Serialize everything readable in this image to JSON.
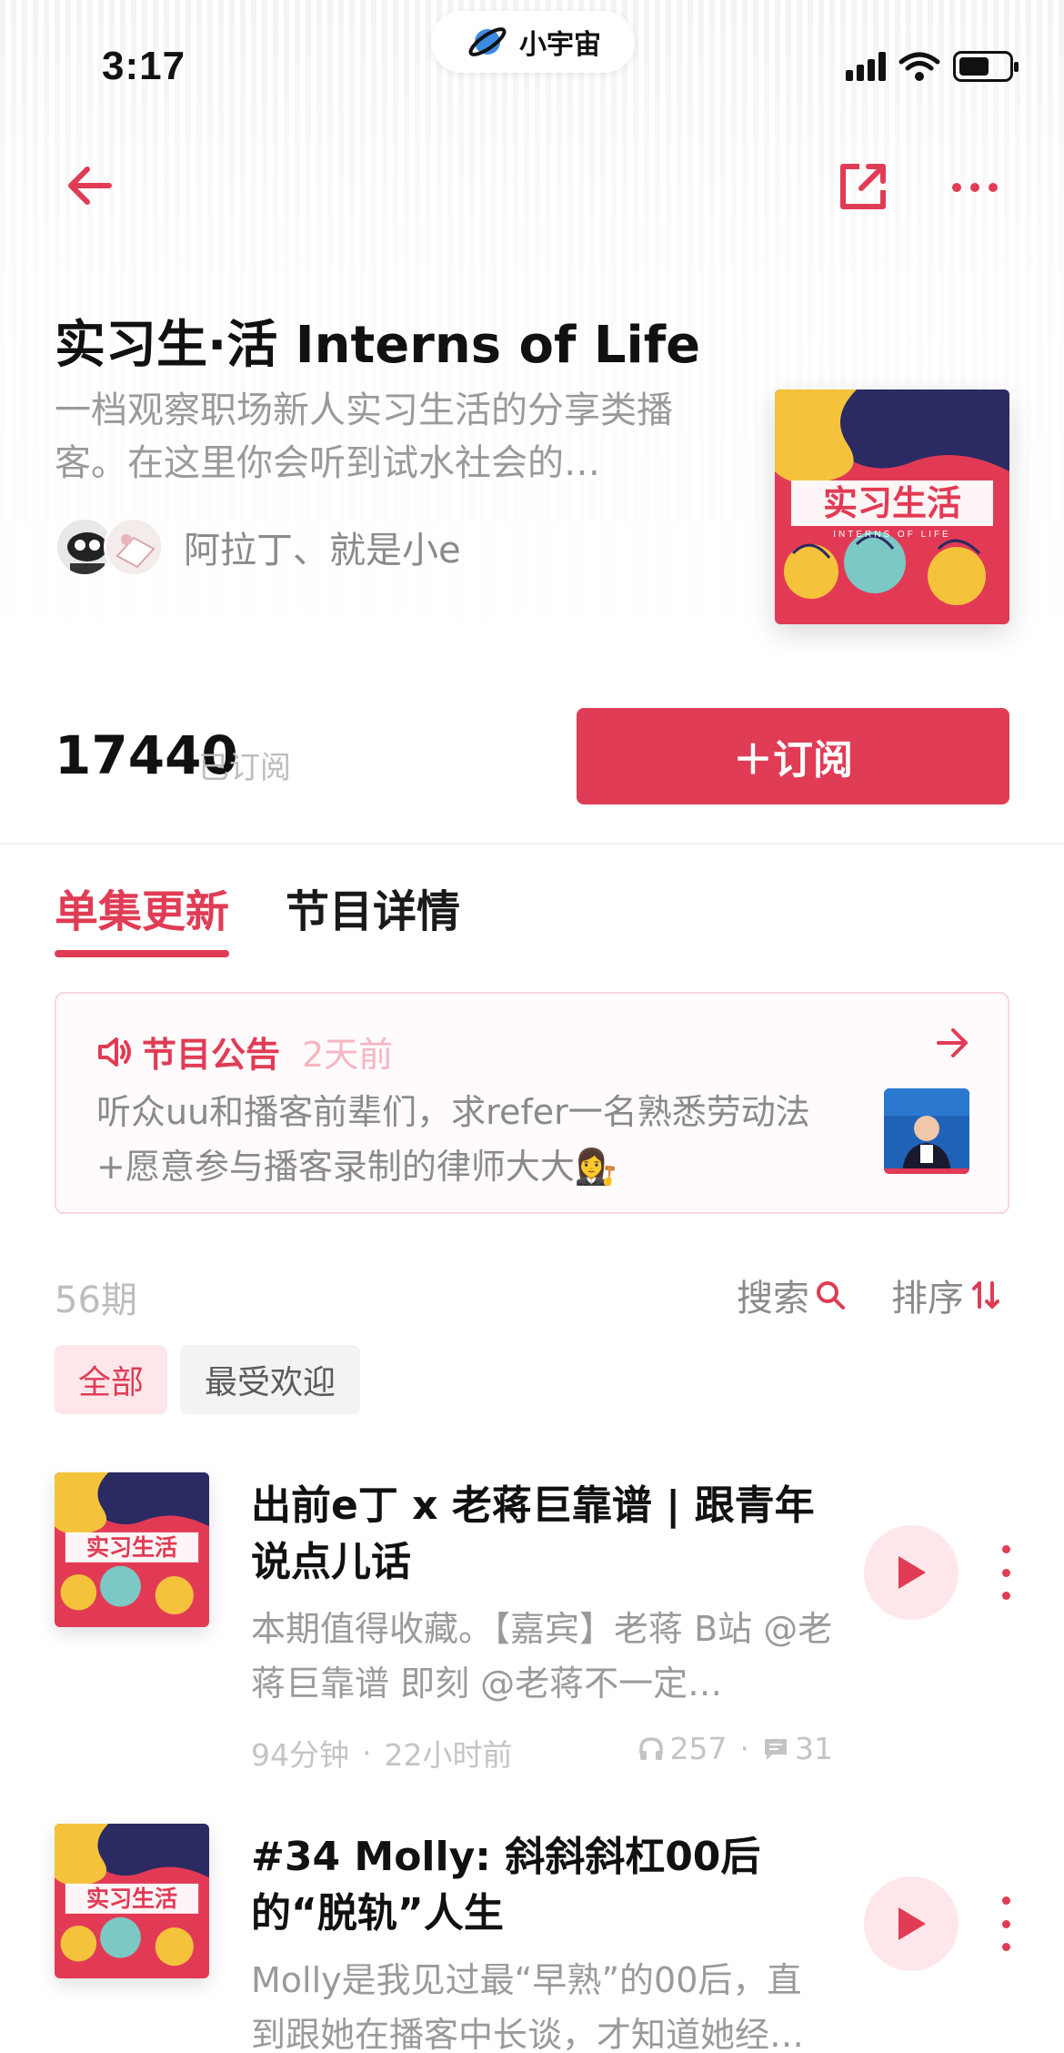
{
  "status_bar": {
    "time": "3:17",
    "app_name": "小宇宙"
  },
  "podcast": {
    "title": "实习生·活 Interns of Life",
    "description": "一档观察职场新人实习生活的分享类播客。在这里你会听到试水社会的…",
    "hosts": "阿拉丁、就是小e",
    "cover_text": {
      "main": "实习生活",
      "sub": "INTERNS OF LIFE"
    },
    "subscriber_count": "17440",
    "subscriber_label": "已订阅",
    "subscribe_label": "＋订阅"
  },
  "tabs": [
    {
      "label": "单集更新",
      "active": true
    },
    {
      "label": "节目详情",
      "active": false
    }
  ],
  "notice": {
    "title": "节目公告",
    "time": "2天前",
    "body": "听众uu和播客前辈们，求refer一名熟悉劳动法+愿意参与播客录制的律师大大👩‍⚖️"
  },
  "list_header": {
    "count": "56期",
    "search_label": "搜索",
    "sort_label": "排序"
  },
  "filters": [
    {
      "label": "全部",
      "active": true
    },
    {
      "label": "最受欢迎",
      "active": false
    }
  ],
  "episodes": [
    {
      "title": "出前e丁 x 老蒋巨靠谱 | 跟青年说点儿话",
      "description": "本期值得收藏。【嘉宾】老蒋 B站 @老蒋巨靠谱 即刻 @老蒋不一定…",
      "duration": "94分钟",
      "published": "22小时前",
      "plays": "257",
      "comments": "31"
    },
    {
      "title": "#34 Molly: 斜斜斜杠00后的“脱轨”人生",
      "description": "Molly是我见过最“早熟”的00后，直到跟她在播客中长谈，才知道她经…",
      "duration": "",
      "published": "",
      "plays": "",
      "comments": ""
    }
  ],
  "colors": {
    "accent": "#e03c55",
    "accent_light": "#fde7eb",
    "cover_navy": "#2b2a63",
    "cover_yellow": "#f5c33b",
    "cover_red": "#e23a55"
  }
}
